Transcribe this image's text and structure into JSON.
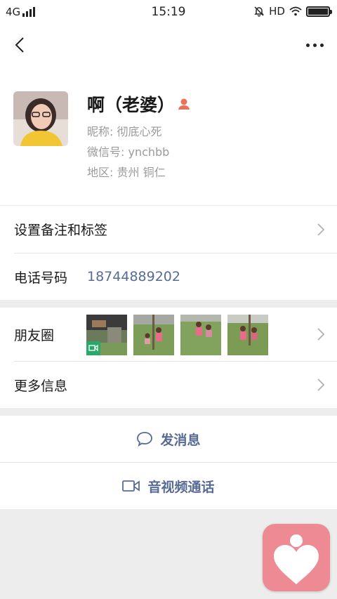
{
  "status_bar": {
    "network": "4G",
    "time": "15:19",
    "hd_label": "HD"
  },
  "nav": {
    "back_icon": "chevron-left-icon",
    "more_icon": "more-horizontal-icon"
  },
  "profile": {
    "name": "啊（老婆）",
    "nickname": "昵称:  彻底心死",
    "wechat_id": "微信号:  ynchbb",
    "region": "地区:  贵州  铜仁"
  },
  "rows": {
    "remark_tags": "设置备注和标签",
    "phone_label": "电话号码",
    "phone_number": "18744889202",
    "moments": "朋友圈",
    "more_info": "更多信息"
  },
  "actions": {
    "send_message": "发消息",
    "av_call": "音视频通话"
  },
  "colors": {
    "link_blue": "#576b95",
    "floating_app_bg": "#ee8a93",
    "contact_badge": "#e8735a"
  }
}
